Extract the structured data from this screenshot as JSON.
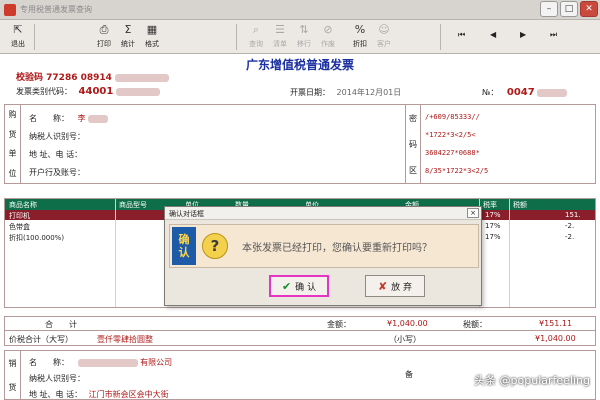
{
  "window": {
    "title": "专用税普通发票查询",
    "controls": [
      "–",
      "□",
      "✕"
    ]
  },
  "toolbar": {
    "exit": "退出",
    "print": "打印",
    "stats": "统计",
    "format": "格式",
    "disabled_buttons": [
      "查询",
      "清单",
      "移行",
      "作废"
    ],
    "discount": "折扣",
    "customer": "客户",
    "nav": [
      "⏮",
      "◀",
      "▶",
      "⏭"
    ]
  },
  "invoice": {
    "title": "广东增值税普通发票",
    "check_code_label": "校验码",
    "check_code_value": "77286 08914",
    "type_code_label": "发票类别代码：",
    "type_code_value": "44001",
    "issue_date_label": "开票日期：",
    "issue_date_value": "2014年12月01日",
    "number_label": "№：",
    "number_value": "0047",
    "purchaser": {
      "side_label": [
        "购",
        "货",
        "单",
        "位"
      ],
      "name_label": "名　　称：",
      "name_value": "李",
      "taxid_label": "纳税人识别号：",
      "addr_label": "地 址、电 话：",
      "bank_label": "开户行及账号："
    },
    "cipher": {
      "side_label": [
        "密",
        "码",
        "区"
      ],
      "lines": [
        "/+609/85333//",
        "*1722*3<2/5<",
        "3604227*0688*",
        "8/35*1722*3<2/5"
      ]
    },
    "goods": {
      "headers": [
        "商品名称",
        "商品型号",
        "单位",
        "数量",
        "单价",
        "金额",
        "税率",
        "税额"
      ],
      "rows": [
        {
          "name": "打印机",
          "rate": "17%",
          "tax": "151."
        },
        {
          "name": "色带盒",
          "rate": "17%",
          "tax": "-2."
        },
        {
          "name": "折扣(100.000%)",
          "rate": "17%",
          "tax": "-2."
        }
      ]
    },
    "totals": {
      "total_label": "合　　计",
      "amount_label": "金额：",
      "amount_value": "¥1,040.00",
      "tax_label": "税额：",
      "tax_value": "¥151.11",
      "upper_label": "价税合计（大写）",
      "upper_value": "壹仟零肆拾圆整",
      "lower_label": "（小写）",
      "lower_value": "¥1,040.00"
    },
    "seller": {
      "side_label": [
        "销",
        "货"
      ],
      "name_label": "名　　称：",
      "name_value": "有限公司",
      "taxid_label": "纳税人识别号：",
      "addr_label": "地 址、电 话：",
      "addr_value": "江门市新会区会中大街",
      "note_label": "备"
    }
  },
  "dialog": {
    "title": "确认对话框",
    "close": "×",
    "confirm_mark": [
      "确",
      "认"
    ],
    "question_glyph": "?",
    "message": "本张发票已经打印，您确认要重新打印吗？",
    "ok": "确 认",
    "cancel": "放 弃"
  },
  "watermark": "头条 @popularfeeling"
}
